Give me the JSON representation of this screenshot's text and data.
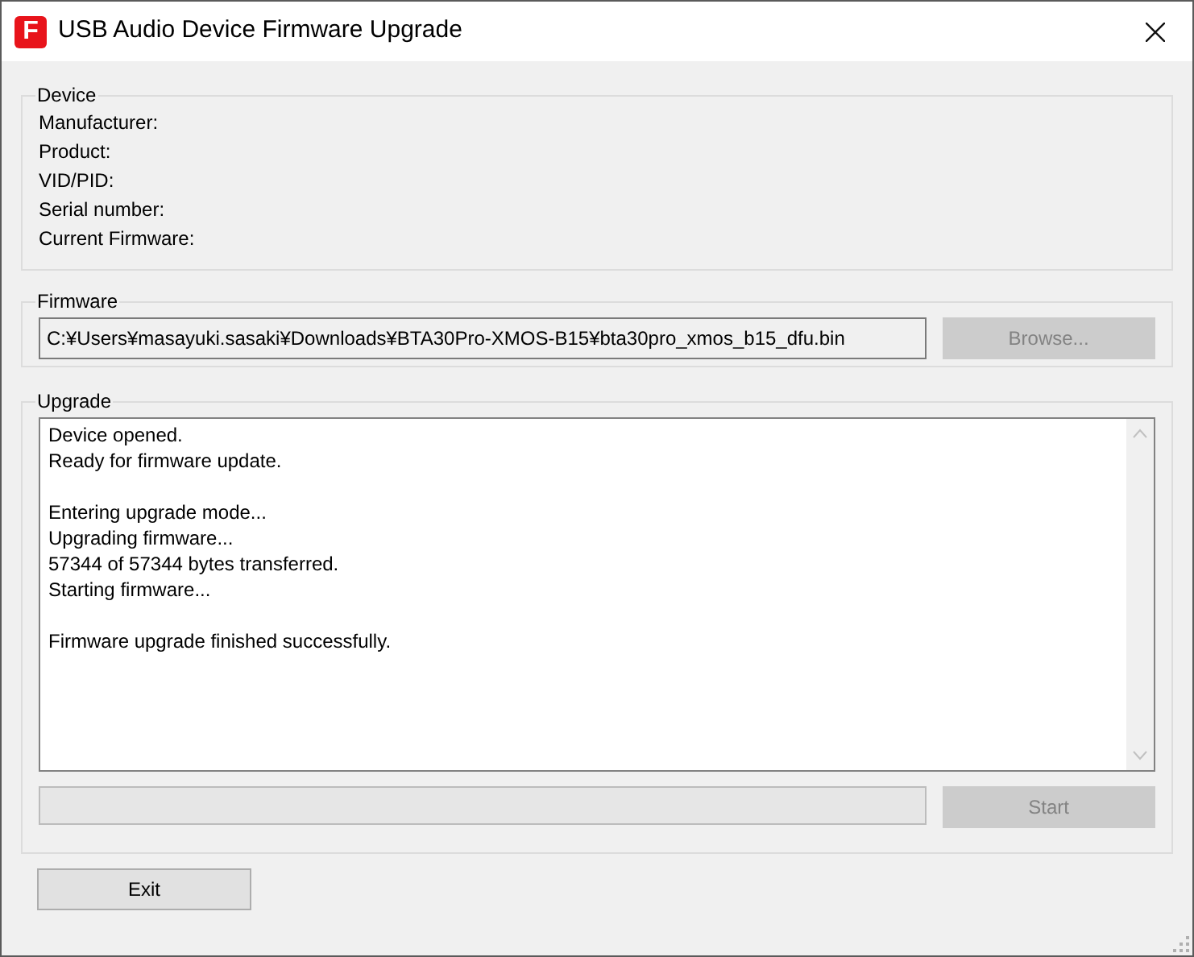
{
  "window": {
    "title": "USB Audio Device Firmware Upgrade",
    "icon_letter": "F"
  },
  "device": {
    "title": "Device",
    "fields": [
      "Manufacturer:",
      "Product:",
      "VID/PID:",
      "Serial number:",
      "Current Firmware:"
    ]
  },
  "firmware": {
    "title": "Firmware",
    "path": "C:¥Users¥masayuki.sasaki¥Downloads¥BTA30Pro-XMOS-B15¥bta30pro_xmos_b15_dfu.bin",
    "browse": {
      "label": "Browse...",
      "disabled": true
    }
  },
  "upgrade": {
    "title": "Upgrade",
    "log": [
      [
        "Device opened.",
        "Ready for firmware update."
      ],
      [
        "Entering upgrade mode...",
        "Upgrading firmware...",
        "57344 of 57344 bytes transferred.",
        "Starting firmware..."
      ],
      [
        "Firmware upgrade finished successfully."
      ]
    ],
    "progress": {
      "level": 0
    },
    "start": {
      "label": "Start",
      "disabled": true
    }
  },
  "exit": {
    "label": "Exit",
    "disabled": false
  }
}
